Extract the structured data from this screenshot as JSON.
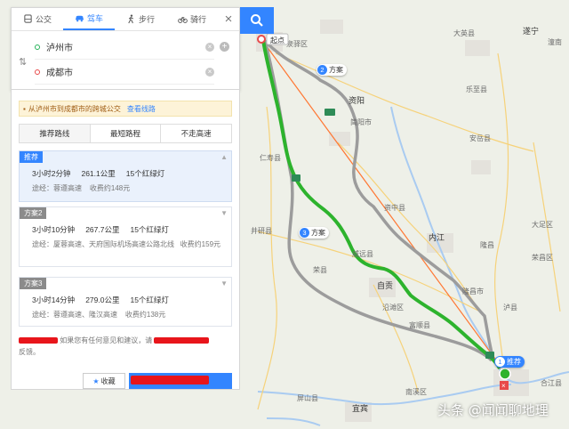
{
  "tabs": [
    {
      "label": "公交",
      "icon": "bus-icon"
    },
    {
      "label": "驾车",
      "icon": "car-icon"
    },
    {
      "label": "步行",
      "icon": "walk-icon"
    },
    {
      "label": "骑行",
      "icon": "bike-icon"
    }
  ],
  "active_tab": "驾车",
  "origin": "泸州市",
  "destination": "成都市",
  "notice": {
    "text": "从泸州市到成都市的跨城公交",
    "link": "查看线路"
  },
  "preferences": [
    "推荐路线",
    "最短路程",
    "不走高速"
  ],
  "plans": [
    {
      "tag": "推荐",
      "time": "3小时2分钟",
      "distance": "261.1公里",
      "lights": "15个红绿灯",
      "via": "途经：蓉遵高速",
      "toll": "收费约148元"
    },
    {
      "tag": "方案2",
      "time": "3小时10分钟",
      "distance": "267.7公里",
      "lights": "15个红绿灯",
      "via": "途经：厦蓉高速、天府国际机场高速公路北线",
      "toll": "收费约159元"
    },
    {
      "tag": "方案3",
      "time": "3小时14分钟",
      "distance": "279.0公里",
      "lights": "15个红绿灯",
      "via": "途经：蓉遵高速、隆汉高速",
      "toll": "收费约138元"
    }
  ],
  "feedback": {
    "before": "如果您有任何意见和建议，请",
    "after": "反馈。"
  },
  "favorite_label": "收藏",
  "map": {
    "start_label": "起点",
    "route_badges": [
      {
        "num": "2",
        "label": "方案"
      },
      {
        "num": "3",
        "label": "方案"
      },
      {
        "num": "1",
        "label": "推荐"
      }
    ],
    "places": [
      "泉驿区",
      "大英县",
      "遂宁市",
      "简阳市",
      "乐至县",
      "资阳市",
      "安岳县",
      "仁寿县",
      "资中县",
      "井研县",
      "内江",
      "威远县",
      "荣县",
      "自贡",
      "隆昌市",
      "泸县",
      "合江县",
      "富顺县",
      "南溪区",
      "屏山县",
      "宜宾",
      "沿滩区",
      "荣昌区",
      "大足区",
      "潼南",
      "龙泉驿区"
    ],
    "colors": {
      "recommended": "#2db32d",
      "alternative": "#9c9c9c",
      "straight_line": "#ff7733"
    }
  },
  "watermark": "头条 @闻闻聊地理"
}
